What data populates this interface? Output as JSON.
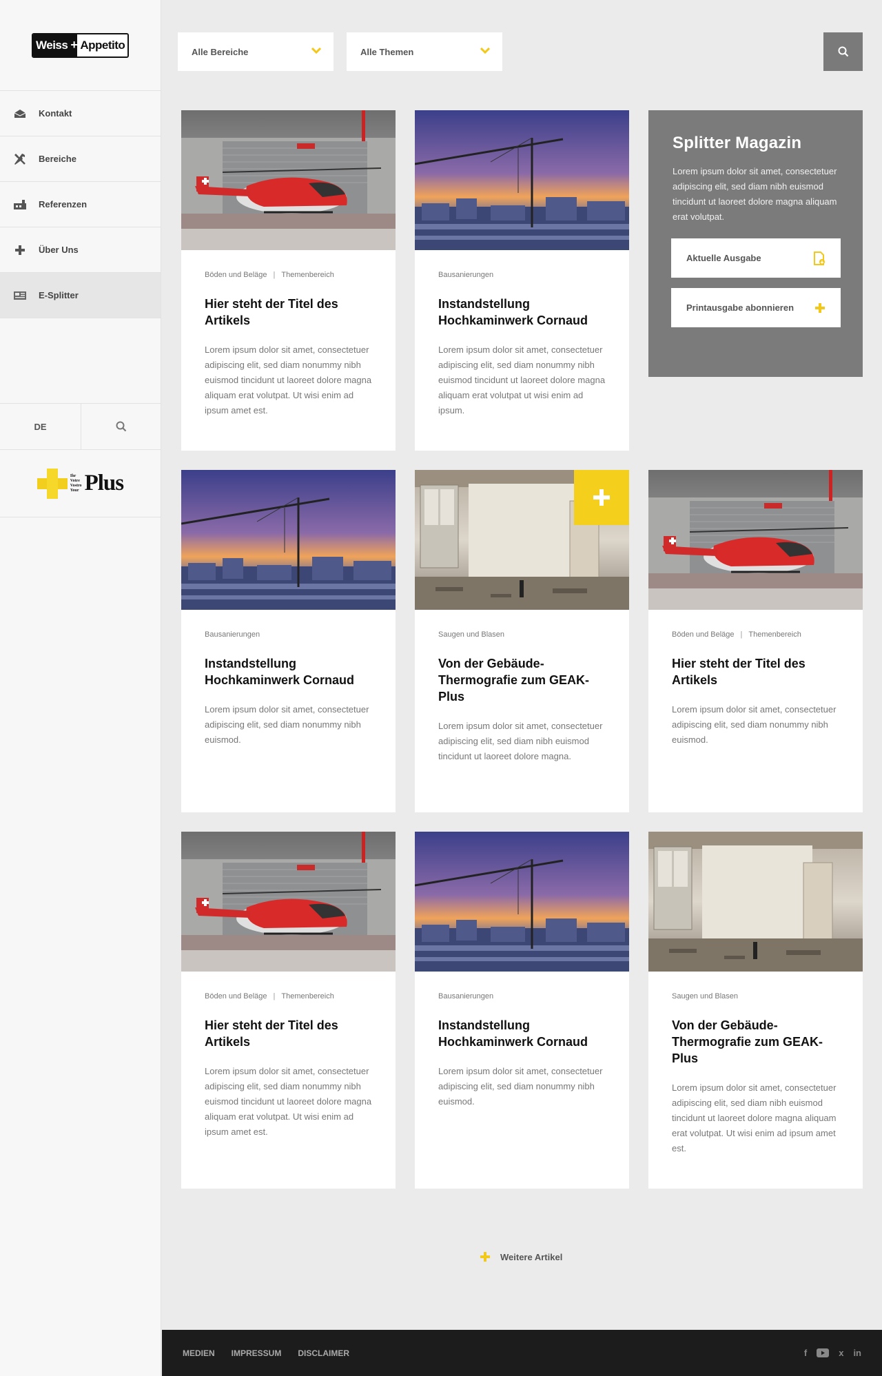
{
  "brand": {
    "logo_left": "Weiss",
    "logo_plus": "+",
    "logo_right": "Appetito"
  },
  "sidebar": {
    "items": [
      {
        "label": "Kontakt",
        "icon": "envelope-icon"
      },
      {
        "label": "Bereiche",
        "icon": "tools-icon"
      },
      {
        "label": "Referenzen",
        "icon": "building-icon"
      },
      {
        "label": "Über Uns",
        "icon": "plus-icon"
      },
      {
        "label": "E-Splitter",
        "icon": "newspaper-icon",
        "active": true
      }
    ],
    "language": "DE",
    "plus_logo": {
      "tiny": [
        "Ihr",
        "Votre",
        "Vostro",
        "Your"
      ],
      "word": "Plus"
    }
  },
  "filters": {
    "bereiche": "Alle Bereiche",
    "themen": "Alle Themen"
  },
  "promo": {
    "title": "Splitter Magazin",
    "text": "Lorem ipsum dolor sit amet, consectetuer adipiscing elit, sed diam nibh euismod tincidunt ut laoreet dolore magna aliquam erat volutpat.",
    "btn_current": "Aktuelle Ausgabe",
    "btn_subscribe": "Printausgabe abonnieren"
  },
  "cards": [
    {
      "cat1": "Böden und Beläge",
      "cat2": "Themenbereich",
      "title": "Hier steht der Titel des Artikels",
      "excerpt": "Lorem ipsum dolor sit amet, consectetuer adipiscing elit, sed diam nonummy nibh euismod tincidunt ut laoreet dolore magna aliquam erat volutpat. Ut wisi enim ad ipsum amet est."
    },
    {
      "cat1": "Bausanierungen",
      "cat2": "",
      "title": "Instandstellung Hochkaminwerk Cornaud",
      "excerpt": "Lorem ipsum dolor sit amet, consectetuer adipiscing elit, sed diam nonummy nibh euismod tincidunt ut laoreet dolore magna aliquam erat volutpat ut wisi enim ad ipsum."
    },
    {
      "cat1": "Bausanierungen",
      "cat2": "",
      "title": "Instandstellung Hochkaminwerk Cornaud",
      "excerpt": "Lorem ipsum dolor sit amet, consectetuer adipiscing elit, sed diam nonummy nibh euismod."
    },
    {
      "cat1": "Saugen und Blasen",
      "cat2": "",
      "title": "Von der Gebäude-Thermografie zum GEAK-Plus",
      "excerpt": "Lorem ipsum dolor sit amet, consectetuer adipiscing elit, sed diam nibh euismod tincidunt ut laoreet dolore magna."
    },
    {
      "cat1": "Böden und Beläge",
      "cat2": "Themenbereich",
      "title": "Hier steht der Titel des Artikels",
      "excerpt": "Lorem ipsum dolor sit amet, consectetuer adipiscing elit, sed diam nonummy nibh euismod."
    },
    {
      "cat1": "Böden und Beläge",
      "cat2": "Themenbereich",
      "title": "Hier steht der Titel des Artikels",
      "excerpt": "Lorem ipsum dolor sit amet, consectetuer adipiscing elit, sed diam nonummy nibh euismod tincidunt ut laoreet dolore magna aliquam erat volutpat. Ut wisi enim ad ipsum amet est."
    },
    {
      "cat1": "Bausanierungen",
      "cat2": "",
      "title": "Instandstellung Hochkaminwerk Cornaud",
      "excerpt": "Lorem ipsum dolor sit amet, consectetuer adipiscing elit, sed diam nonummy nibh euismod."
    },
    {
      "cat1": "Saugen und Blasen",
      "cat2": "",
      "title": "Von der Gebäude-Thermografie zum GEAK-Plus",
      "excerpt": "Lorem ipsum dolor sit amet, consectetuer adipiscing elit, sed diam nibh euismod tincidunt ut laoreet dolore magna aliquam erat volutpat. Ut wisi enim ad ipsum amet est."
    }
  ],
  "more_label": "Weitere Artikel",
  "footer": {
    "links": [
      "MEDIEN",
      "IMPRESSUM",
      "DISCLAIMER"
    ],
    "social": [
      "facebook-icon",
      "youtube-icon",
      "xing-icon",
      "linkedin-icon"
    ],
    "social_labels": {
      "facebook": "f",
      "xing": "x",
      "linkedin": "in"
    }
  },
  "colors": {
    "accent": "#f4cf1c",
    "promo_bg": "#7b7b7b",
    "footer_bg": "#1c1c1c",
    "page_bg": "#ebebeb"
  }
}
